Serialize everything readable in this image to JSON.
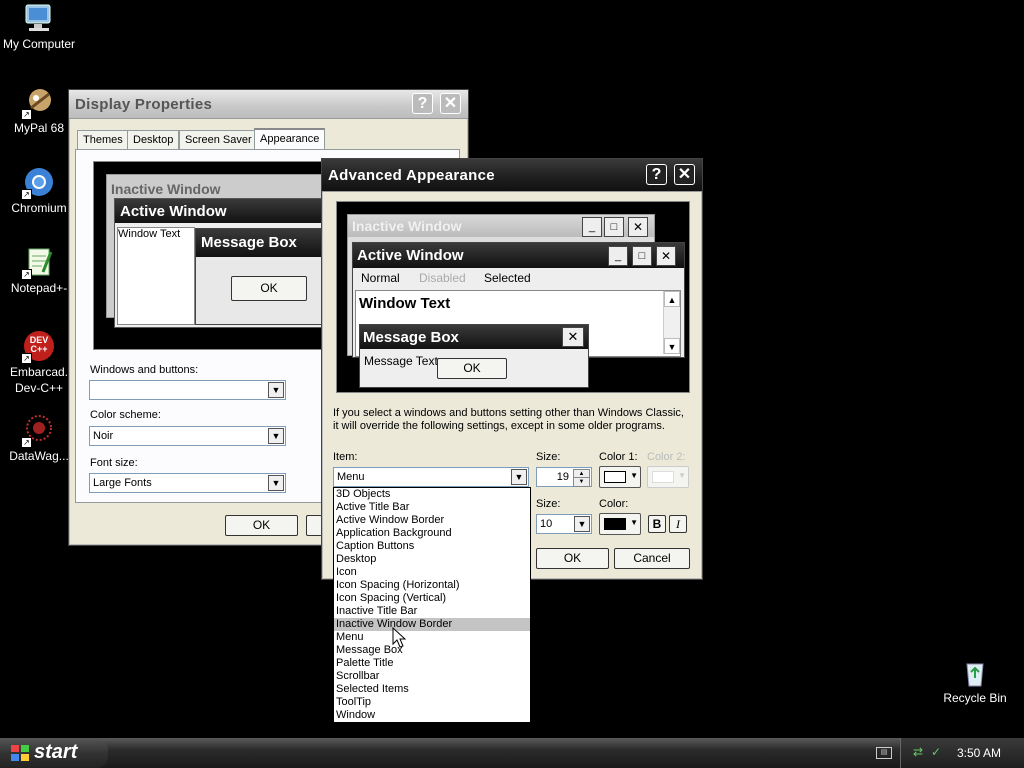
{
  "desktop": {
    "icons": [
      {
        "label": "My Computer",
        "icon": "computer-icon"
      },
      {
        "label": "MyPal 68",
        "icon": "mypal-icon"
      },
      {
        "label": "Chromium",
        "icon": "chromium-icon"
      },
      {
        "label": "Notepad+-",
        "icon": "notepad-icon"
      },
      {
        "label": "Embarcad. Dev-C++",
        "icon": "devcpp-icon",
        "badge": "DEV C++"
      },
      {
        "label": "DataWag...",
        "icon": "datawag-icon"
      }
    ],
    "recycle_bin": {
      "label": "Recycle Bin",
      "icon": "recycle-bin-icon"
    }
  },
  "display_properties": {
    "title": "Display Properties",
    "help": "?",
    "close": "✕",
    "tabs": [
      "Themes",
      "Desktop",
      "Screen Saver",
      "Appearance"
    ],
    "selected_tab": "Appearance",
    "preview": {
      "inactive_title": "Inactive Window",
      "active_title": "Active Window",
      "window_text": "Window Text",
      "message_box_title": "Message Box",
      "ok_label": "OK"
    },
    "windows_and_buttons_label": "Windows and buttons:",
    "windows_and_buttons_value": "",
    "color_scheme_label": "Color scheme:",
    "color_scheme_value": "Noir",
    "font_size_label": "Font size:",
    "font_size_value": "Large Fonts",
    "ok_label": "OK"
  },
  "advanced_appearance": {
    "title": "Advanced Appearance",
    "help": "?",
    "close": "✕",
    "preview": {
      "inactive_title": "Inactive Window",
      "active_title": "Active Window",
      "menu_normal": "Normal",
      "menu_disabled": "Disabled",
      "menu_selected": "Selected",
      "window_text": "Window Text",
      "message_box_title": "Message Box",
      "message_text": "Message Text",
      "ok_label": "OK"
    },
    "note_line1": "If you select a windows and buttons setting other than Windows Classic,",
    "note_line2": "it will override the following settings, except in some older programs.",
    "item_label": "Item:",
    "item_value": "Menu",
    "size_label": "Size:",
    "size_value": "19",
    "color1_label": "Color 1:",
    "color2_label": "Color 2:",
    "font_size_label": "Size:",
    "font_size_value": "10",
    "font_color_label": "Color:",
    "bold_label": "B",
    "italic_label": "I",
    "ok_label": "OK",
    "cancel_label": "Cancel",
    "item_options": [
      "3D Objects",
      "Active Title Bar",
      "Active Window Border",
      "Application Background",
      "Caption Buttons",
      "Desktop",
      "Icon",
      "Icon Spacing (Horizontal)",
      "Icon Spacing (Vertical)",
      "Inactive Title Bar",
      "Inactive Window Border",
      "Menu",
      "Message Box",
      "Palette Title",
      "Scrollbar",
      "Selected Items",
      "ToolTip",
      "Window"
    ],
    "highlighted_option": "Inactive Window Border"
  },
  "taskbar": {
    "start_label": "start",
    "clock": "3:50 AM"
  },
  "colors": {
    "desktop": "#000000",
    "dialog_face": "#ece9d8",
    "active_title": "#1e1e1e"
  }
}
